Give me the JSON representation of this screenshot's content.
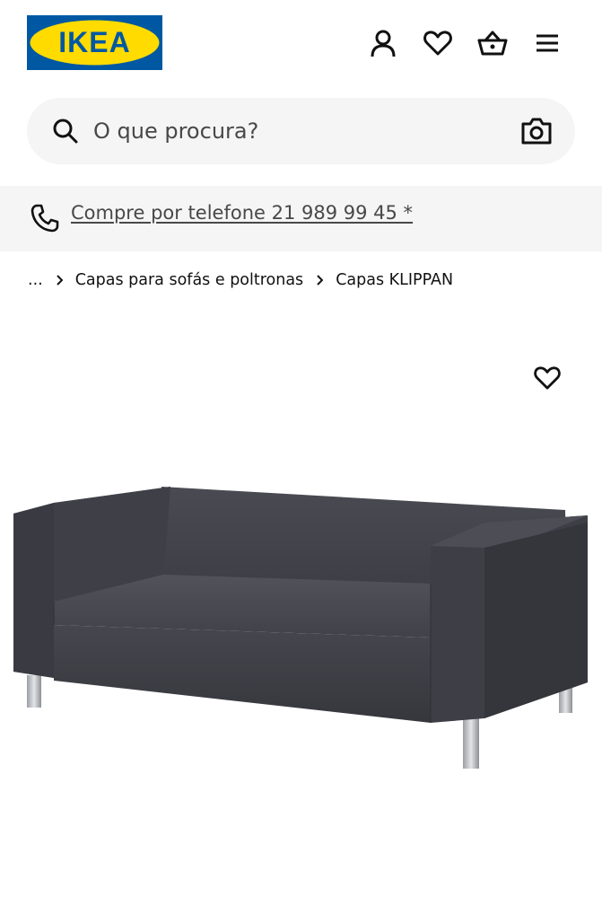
{
  "header": {
    "logo_text": "IKEA",
    "brand_colors": {
      "blue": "#0058a3",
      "yellow": "#ffdb00"
    },
    "icons": [
      "user-icon",
      "heart-icon",
      "cart-icon",
      "menu-icon"
    ]
  },
  "search": {
    "placeholder": "O que procura?",
    "icons": [
      "search-icon",
      "camera-icon"
    ]
  },
  "phone_bar": {
    "icon": "phone-icon",
    "link_text": "Compre por telefone 21 989 99 45 *"
  },
  "breadcrumb": {
    "items": [
      "...",
      "Capas para sofás e poltronas",
      "Capas KLIPPAN"
    ]
  },
  "product": {
    "favorite_icon": "heart-icon",
    "image_subject": "sofa",
    "image_alt": "Capas KLIPPAN"
  }
}
